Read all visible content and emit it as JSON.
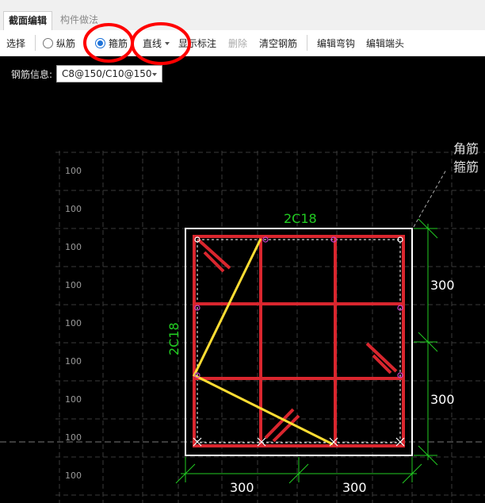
{
  "tabs": [
    {
      "label": "截面编辑"
    },
    {
      "label": "构件做法"
    }
  ],
  "toolbar": {
    "select": "选择",
    "longitudinal": "纵筋",
    "stirrup": "箍筋",
    "line_mode": "直线",
    "show_annotation": "显示标注",
    "delete": "删除",
    "clear_rebar": "清空钢筋",
    "edit_hook": "编辑弯钩",
    "edit_end": "编辑端头"
  },
  "rebar_info": {
    "label": "钢筋信息:",
    "value": "C8@150/C10@150"
  },
  "drawing": {
    "corner_label": "角筋",
    "stirrup_label": "箍筋",
    "top_rebar": "2C18",
    "side_rebar": "2C18",
    "dim_right_top": "300",
    "dim_right_bottom": "300",
    "dim_bottom_left": "300",
    "dim_bottom_right": "300",
    "grid_label": "100"
  },
  "colors": {
    "rebar": "#d9262e",
    "stirrup_selected": "#ffdd33",
    "dimension": "#22cc22",
    "outline": "#ffffff",
    "grid": "#3a3a3a",
    "highlight_circle": "#ff0000",
    "radio_accent": "#1e73d9"
  }
}
